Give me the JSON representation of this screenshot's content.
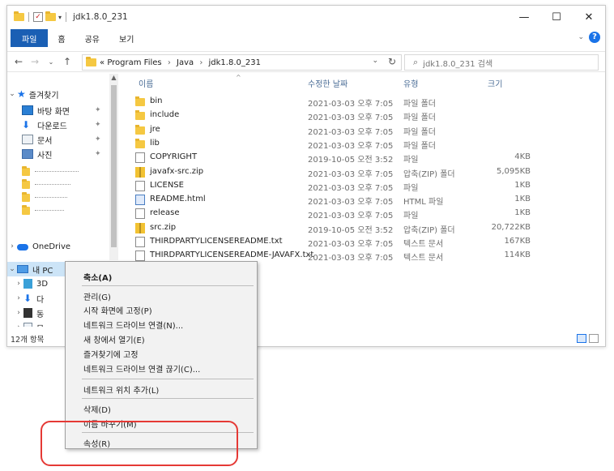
{
  "window": {
    "title": "jdk1.8.0_231",
    "controls": {
      "minimize": "—",
      "maximize": "☐",
      "close": "✕"
    }
  },
  "ribbon": {
    "tabs": [
      "파일",
      "홈",
      "공유",
      "보기"
    ]
  },
  "address": {
    "prefix": "«",
    "crumbs": [
      "Program Files",
      "Java",
      "jdk1.8.0_231"
    ],
    "separator": "›",
    "search_placeholder": "jdk1.8.0_231 검색"
  },
  "nav": {
    "quick_access": "즐겨찾기",
    "pinned": [
      {
        "label": "바탕 화면",
        "icon": "desktop-icon"
      },
      {
        "label": "다운로드",
        "icon": "download-icon"
      },
      {
        "label": "문서",
        "icon": "documents-icon"
      },
      {
        "label": "사진",
        "icon": "pictures-icon"
      }
    ],
    "onedrive": "OneDrive",
    "this_pc": "내 PC",
    "pc_children": [
      "3D",
      "다",
      "동",
      "문"
    ],
    "status": "12개 항목"
  },
  "columns": {
    "name": "이름",
    "date": "수정한 날짜",
    "type": "유형",
    "size": "크기"
  },
  "files": [
    {
      "name": "bin",
      "date": "2021-03-03 오후 7:05",
      "type": "파일 폴더",
      "size": "",
      "icon": "folder"
    },
    {
      "name": "include",
      "date": "2021-03-03 오후 7:05",
      "type": "파일 폴더",
      "size": "",
      "icon": "folder"
    },
    {
      "name": "jre",
      "date": "2021-03-03 오후 7:05",
      "type": "파일 폴더",
      "size": "",
      "icon": "folder"
    },
    {
      "name": "lib",
      "date": "2021-03-03 오후 7:05",
      "type": "파일 폴더",
      "size": "",
      "icon": "folder"
    },
    {
      "name": "COPYRIGHT",
      "date": "2019-10-05 오전 3:52",
      "type": "파일",
      "size": "4KB",
      "icon": "file"
    },
    {
      "name": "javafx-src.zip",
      "date": "2021-03-03 오후 7:05",
      "type": "압축(ZIP) 폴더",
      "size": "5,095KB",
      "icon": "zip"
    },
    {
      "name": "LICENSE",
      "date": "2021-03-03 오후 7:05",
      "type": "파일",
      "size": "1KB",
      "icon": "file"
    },
    {
      "name": "README.html",
      "date": "2021-03-03 오후 7:05",
      "type": "HTML 파일",
      "size": "1KB",
      "icon": "html"
    },
    {
      "name": "release",
      "date": "2021-03-03 오후 7:05",
      "type": "파일",
      "size": "1KB",
      "icon": "file"
    },
    {
      "name": "src.zip",
      "date": "2019-10-05 오전 3:52",
      "type": "압축(ZIP) 폴더",
      "size": "20,722KB",
      "icon": "zip"
    },
    {
      "name": "THIRDPARTYLICENSEREADME.txt",
      "date": "2021-03-03 오후 7:05",
      "type": "텍스트 문서",
      "size": "167KB",
      "icon": "file"
    },
    {
      "name": "THIRDPARTYLICENSEREADME-JAVAFX.txt",
      "date": "2021-03-03 오후 7:05",
      "type": "텍스트 문서",
      "size": "114KB",
      "icon": "file"
    }
  ],
  "context_menu": {
    "collapse": "축소(A)",
    "manage": "관리(G)",
    "pin_start": "시작 화면에 고정(P)",
    "map_drive": "네트워크 드라이브 연결(N)...",
    "open_new": "새 창에서 열기(E)",
    "pin_quick": "즐겨찾기에 고정",
    "disconnect": "네트워크 드라이브 연결 끊기(C)...",
    "add_location": "네트워크 위치 추가(L)",
    "delete": "삭제(D)",
    "rename": "이름 바꾸기(M)",
    "properties": "속성(R)"
  },
  "colors": {
    "accent": "#1a5fb4",
    "folder": "#f5c842",
    "highlight": "#e53935"
  }
}
